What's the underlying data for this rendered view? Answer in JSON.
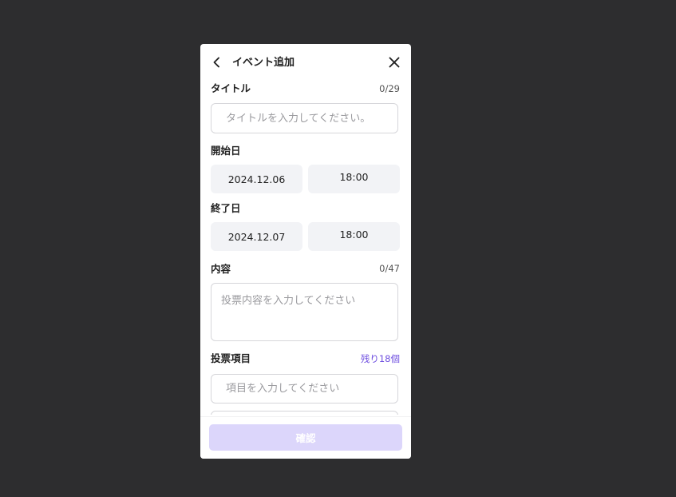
{
  "header": {
    "title": "イベント追加"
  },
  "form": {
    "title": {
      "label": "タイトル",
      "counter": "0/29",
      "placeholder": "タイトルを入力してください。"
    },
    "start": {
      "label": "開始日",
      "date": "2024.12.06",
      "time": "18:00"
    },
    "end": {
      "label": "終了日",
      "date": "2024.12.07",
      "time": "18:00"
    },
    "content": {
      "label": "内容",
      "counter": "0/47",
      "placeholder": "投票内容を入力してください"
    },
    "poll": {
      "label": "投票項目",
      "remaining": "残り18個",
      "item_placeholder": "項目を入力してください"
    }
  },
  "footer": {
    "confirm_label": "確認"
  },
  "icons": {
    "back": "chevron-left-icon",
    "close": "close-icon"
  },
  "colors": {
    "backdrop": "#2d2d2f",
    "accent": "#6f4fe0",
    "confirm_disabled_bg": "#dcd6fb",
    "pill_bg": "#f2f3f6"
  }
}
